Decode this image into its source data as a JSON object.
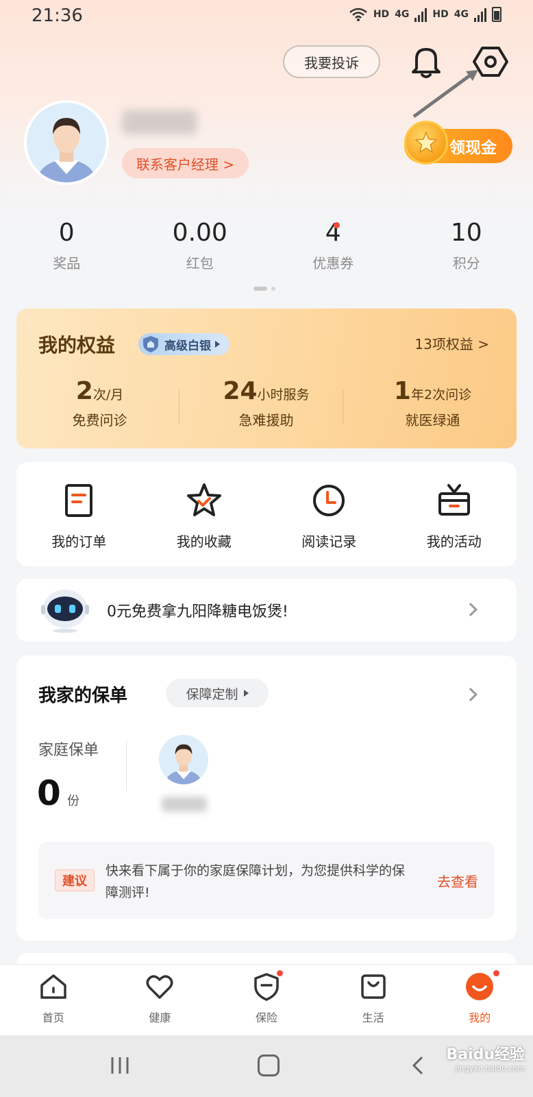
{
  "status_bar": {
    "time": "21:36",
    "network_1": "HD",
    "signal_1": "4G",
    "network_2": "HD",
    "signal_2": "4G"
  },
  "header": {
    "complain_label": "我要投诉",
    "bell_icon": "bell-icon",
    "settings_icon": "settings-icon"
  },
  "profile": {
    "contact_manager_label": "联系客户经理 >",
    "get_cash_label": "领现金"
  },
  "stats": [
    {
      "value": "0",
      "label": "奖品"
    },
    {
      "value": "0.00",
      "label": "红包"
    },
    {
      "value": "4",
      "label": "优惠券"
    },
    {
      "value": "10",
      "label": "积分"
    }
  ],
  "benefits": {
    "title": "我的权益",
    "level": "高级白银",
    "count_label": "13项权益 >",
    "items": [
      {
        "num": "2",
        "unit": "次/月",
        "label": "免费问诊"
      },
      {
        "num": "24",
        "unit": "小时服务",
        "label": "急难援助"
      },
      {
        "num": "1",
        "unit": "年2次问诊",
        "label": "就医绿通"
      }
    ]
  },
  "quick_actions": [
    {
      "label": "我的订单",
      "icon": "order-icon"
    },
    {
      "label": "我的收藏",
      "icon": "star-icon"
    },
    {
      "label": "阅读记录",
      "icon": "clock-icon"
    },
    {
      "label": "我的活动",
      "icon": "gift-icon"
    }
  ],
  "promo": {
    "text": "0元免费拿九阳降糖电饭煲!"
  },
  "policy": {
    "title": "我家的保单",
    "custom_label": "保障定制",
    "family_label": "家庭保单",
    "count": "0",
    "unit": "份",
    "suggest_tag": "建议",
    "suggest_text": "快来看下属于你的家庭保障计划，为您提供科学的保障测评!",
    "suggest_link": "去查看"
  },
  "tabs": [
    {
      "label": "首页",
      "icon": "home-icon"
    },
    {
      "label": "健康",
      "icon": "heart-icon"
    },
    {
      "label": "保险",
      "icon": "shield-icon"
    },
    {
      "label": "生活",
      "icon": "bag-icon"
    },
    {
      "label": "我的",
      "icon": "smile-icon"
    }
  ],
  "watermark": {
    "brand": "Baidu经验",
    "url": "jingyan.baidu.com"
  },
  "colors": {
    "accent": "#f2561d",
    "cash_button": "#ff9a20",
    "benefits_bg": "#fdd8a0"
  }
}
